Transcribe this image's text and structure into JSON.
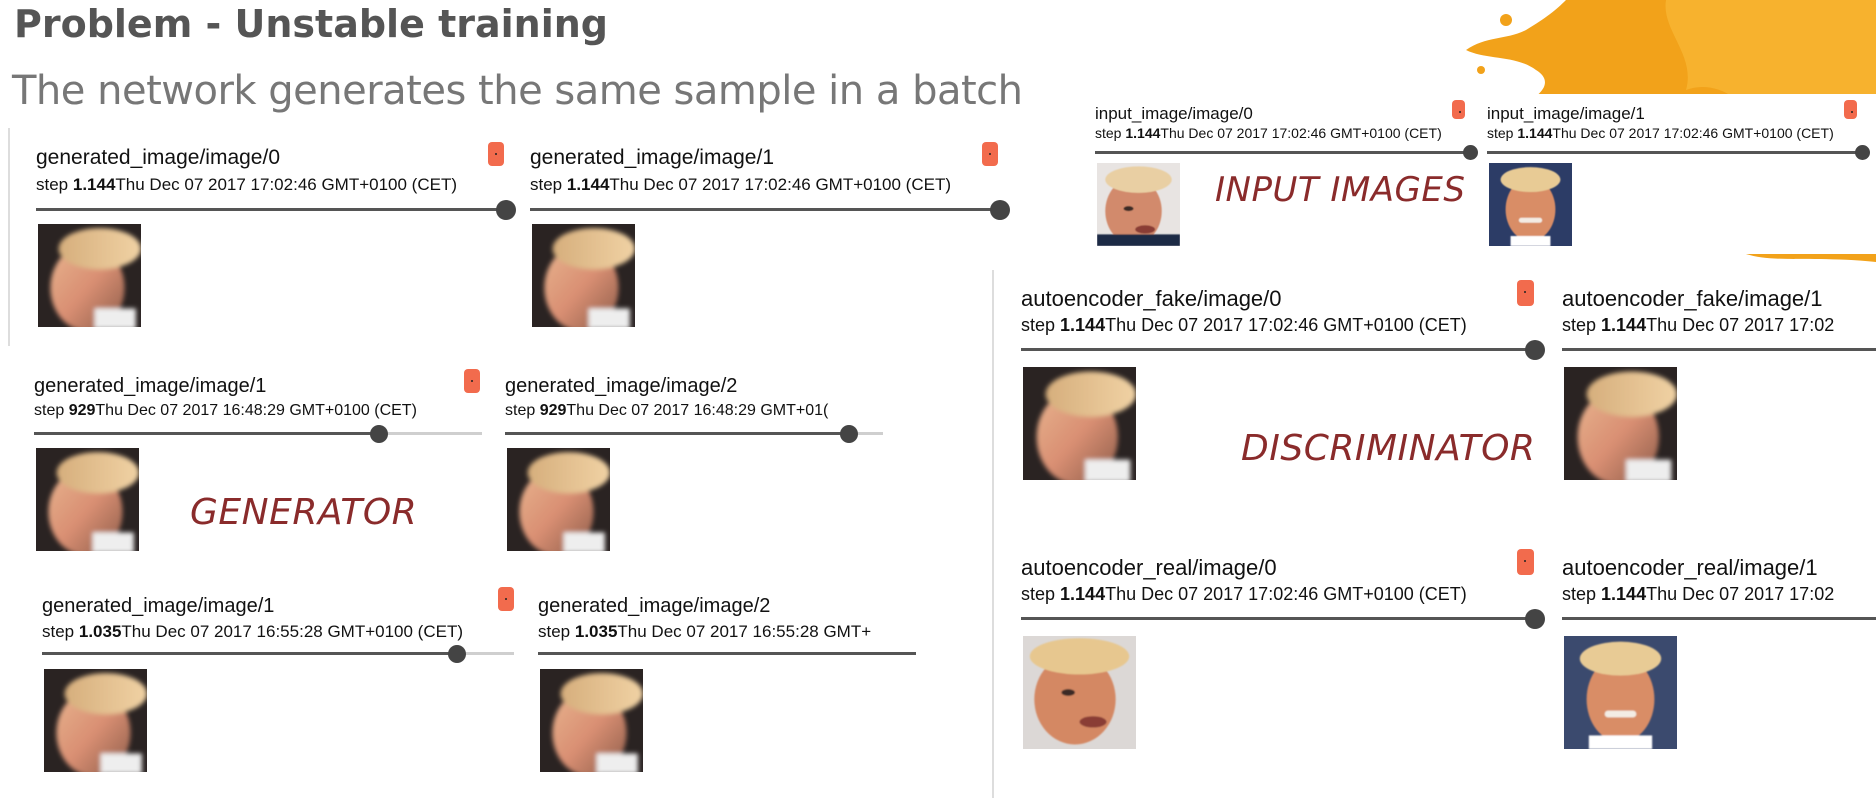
{
  "slide": {
    "title": "Problem - Unstable training",
    "subtitle": "The network generates the same sample in a batch"
  },
  "labels": {
    "generator": "GENERATOR",
    "discriminator": "DISCRIMINATOR",
    "input_images": "INPUT IMAGES"
  },
  "cards": {
    "gen_a0": {
      "name": "generated_image/image/0",
      "step_prefix": "step ",
      "step": "1.144",
      "date": "Thu Dec 07 2017 17:02:46 GMT+0100 (CET)",
      "slider_fraction": 1.0
    },
    "gen_a1": {
      "name": "generated_image/image/1",
      "step_prefix": "step ",
      "step": "1.144",
      "date": "Thu Dec 07 2017 17:02:46 GMT+0100 (CET)",
      "slider_fraction": 1.0
    },
    "gen_b1": {
      "name": "generated_image/image/1",
      "step_prefix": "step ",
      "step": "929",
      "date": "Thu Dec 07 2017 16:48:29 GMT+0100 (CET)",
      "slider_fraction": 0.77
    },
    "gen_b2": {
      "name": "generated_image/image/2",
      "step_prefix": "step ",
      "step": "929",
      "date": "Thu Dec 07 2017 16:48:29 GMT+01(",
      "slider_fraction": 0.91
    },
    "gen_c1": {
      "name": "generated_image/image/1",
      "step_prefix": "step ",
      "step": "1.035",
      "date": "Thu Dec 07 2017 16:55:28 GMT+0100 (CET)",
      "slider_fraction": 0.88
    },
    "gen_c2": {
      "name": "generated_image/image/2",
      "step_prefix": "step ",
      "step": "1.035",
      "date": "Thu Dec 07 2017 16:55:28 GMT+",
      "slider_fraction": 1.0
    },
    "in_0": {
      "name": "input_image/image/0",
      "step_prefix": "step ",
      "step": "1.144",
      "date": "Thu Dec 07 2017 17:02:46 GMT+0100 (CET)",
      "slider_fraction": 1.0
    },
    "in_1": {
      "name": "input_image/image/1",
      "step_prefix": "step ",
      "step": "1.144",
      "date": "Thu Dec 07 2017 17:02:46 GMT+0100 (CET)",
      "slider_fraction": 1.0
    },
    "ae_fake0": {
      "name": "autoencoder_fake/image/0",
      "step_prefix": "step ",
      "step": "1.144",
      "date": "Thu Dec 07 2017 17:02:46 GMT+0100 (CET)",
      "slider_fraction": 1.0
    },
    "ae_fake1": {
      "name": "autoencoder_fake/image/1",
      "step_prefix": "step ",
      "step": "1.144",
      "date": "Thu Dec 07 2017 17:02",
      "slider_fraction": 1.0
    },
    "ae_real0": {
      "name": "autoencoder_real/image/0",
      "step_prefix": "step ",
      "step": "1.144",
      "date": "Thu Dec 07 2017 17:02:46 GMT+0100 (CET)",
      "slider_fraction": 1.0
    },
    "ae_real1": {
      "name": "autoencoder_real/image/1",
      "step_prefix": "step ",
      "step": "1.144",
      "date": "Thu Dec 07 2017 17:02",
      "slider_fraction": 1.0
    }
  },
  "colors": {
    "badge": "#f26b4d",
    "label_text": "#8a2b2b",
    "splash": "#f2a21a"
  },
  "icons": {
    "badge": "sample-marker-icon",
    "face": "face-thumbnail"
  }
}
